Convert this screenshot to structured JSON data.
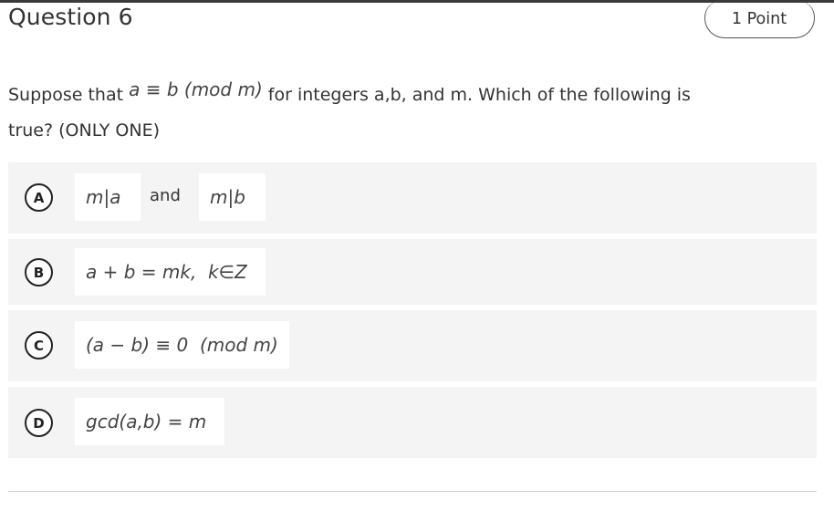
{
  "header": {
    "title": "Question 6",
    "points_badge": "1 Point"
  },
  "question": {
    "prefix": "Suppose that",
    "math_expr": "a ≡ b  (mod m)",
    "suffix": "for integers a,b, and m. Which of the following is",
    "line2": "true? (ONLY ONE)"
  },
  "choices": [
    {
      "letter": "A",
      "math_1": "m|a",
      "connector": "and",
      "math_2": "m|b",
      "selected": false
    },
    {
      "letter": "B",
      "math_1": "a + b = mk,  k∈Z",
      "selected": false
    },
    {
      "letter": "C",
      "math_1": "(a − b) ≡ 0  (mod m)",
      "selected": false
    },
    {
      "letter": "D",
      "math_1": "gcd(a,b) = m",
      "selected": false
    }
  ]
}
